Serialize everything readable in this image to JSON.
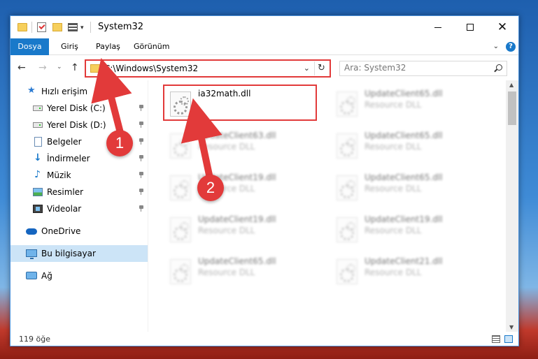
{
  "window": {
    "title": "System32",
    "minimize_label": "",
    "maximize_label": "",
    "close_label": "✕"
  },
  "ribbon": {
    "tabs": [
      {
        "label": "Dosya",
        "active": true
      },
      {
        "label": "Giriş"
      },
      {
        "label": "Paylaş"
      },
      {
        "label": "Görünüm"
      }
    ],
    "chevron": "⌄",
    "help": "?"
  },
  "nav": {
    "back": "←",
    "forward": "→",
    "dropdown": "⌄",
    "up": "↑"
  },
  "address": {
    "path": "C:\\Windows\\System32",
    "dropdown": "⌄",
    "refresh": "↻"
  },
  "search": {
    "placeholder": "Ara: System32"
  },
  "sidebar": {
    "items": [
      {
        "label": "Hızlı erişim",
        "icon": "star-icon"
      },
      {
        "label": "Yerel Disk (C:)",
        "icon": "disk-icon",
        "pinned": true
      },
      {
        "label": "Yerel Disk (D:)",
        "icon": "disk-icon",
        "pinned": true
      },
      {
        "label": "Belgeler",
        "icon": "document-icon",
        "pinned": true
      },
      {
        "label": "İndirmeler",
        "icon": "download-icon",
        "pinned": true
      },
      {
        "label": "Müzik",
        "icon": "music-icon",
        "pinned": true
      },
      {
        "label": "Resimler",
        "icon": "pictures-icon",
        "pinned": true
      },
      {
        "label": "Videolar",
        "icon": "videos-icon",
        "pinned": true
      },
      {
        "label": "OneDrive",
        "icon": "cloud-icon"
      },
      {
        "label": "Bu bilgisayar",
        "icon": "computer-icon",
        "selected": true
      },
      {
        "label": "Ağ",
        "icon": "network-icon"
      }
    ]
  },
  "files": [
    {
      "name": "ia32math.dll",
      "type": "",
      "highlighted": true
    },
    {
      "name": "UpdateClient65.dll",
      "type": "Resource DLL"
    },
    {
      "name": "UpdateClient63.dll",
      "type": "Resource DLL"
    },
    {
      "name": "UpdateClient65.dll",
      "type": "Resource DLL"
    },
    {
      "name": "UpdateClient19.dll",
      "type": "Resource DLL"
    },
    {
      "name": "UpdateClient65.dll",
      "type": "Resource DLL"
    },
    {
      "name": "UpdateClient19.dll",
      "type": "Resource DLL"
    },
    {
      "name": "UpdateClient19.dll",
      "type": "Resource DLL"
    },
    {
      "name": "UpdateClient65.dll",
      "type": "Resource DLL"
    },
    {
      "name": "UpdateClient21.dll",
      "type": "Resource DLL"
    }
  ],
  "status": {
    "count": "119 öğe"
  },
  "annotations": {
    "step1": "1",
    "step2": "2",
    "color": "#e23a3a"
  }
}
